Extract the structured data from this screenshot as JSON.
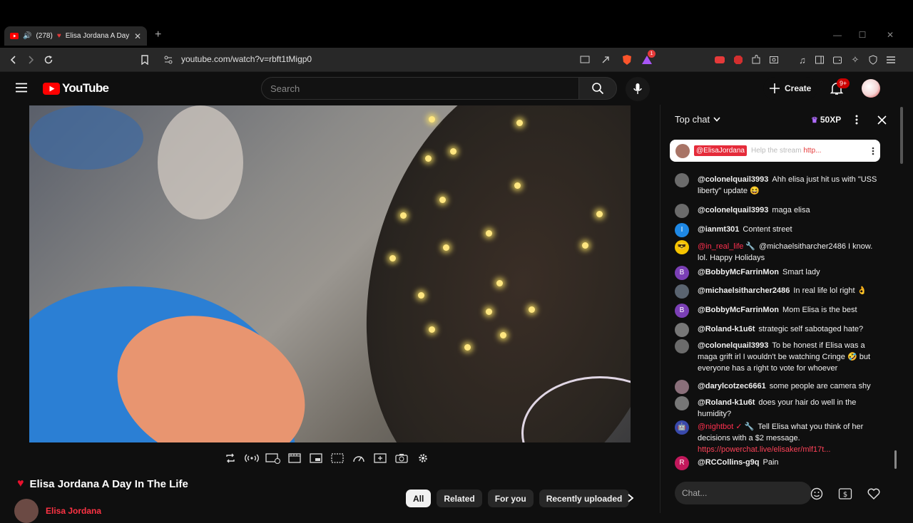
{
  "browser": {
    "tab": {
      "audio_count": "(278)",
      "title": "Elisa Jordana A Day In The Life"
    },
    "url": "youtube.com/watch?v=rbft1tMigp0",
    "brave_badge": "1"
  },
  "youtube": {
    "logo_text": "YouTube",
    "search_placeholder": "Search",
    "create_label": "Create",
    "notification_badge": "9+"
  },
  "video": {
    "title": "Elisa Jordana A Day In The Life",
    "channel": "Elisa Jordana"
  },
  "chips": [
    "All",
    "Related",
    "For you",
    "Recently uploaded"
  ],
  "chat": {
    "mode": "Top chat",
    "xp": "50XP",
    "pinned": {
      "author": "@ElisaJordana",
      "text": "Help the stream",
      "link": "http..."
    },
    "messages": [
      {
        "author": "@colonelquail3993",
        "text": "Ahh elisa just hit us with \"USS liberty\" update 😆",
        "avatar": "",
        "avatar_color": "#6b6b6b"
      },
      {
        "author": "@colonelquail3993",
        "text": "maga elisa",
        "avatar": "",
        "avatar_color": "#6b6b6b"
      },
      {
        "author": "@ianmt301",
        "text": "Content street",
        "avatar": "I",
        "avatar_color": "#1e88e5"
      },
      {
        "author": "@in_real_life 🔧",
        "text": "@michaelsitharcher2486 I know. lol. Happy Holidays",
        "avatar": "😎",
        "avatar_color": "#f5c400",
        "red": true
      },
      {
        "author": "@BobbyMcFarrinMon",
        "text": "Smart lady",
        "avatar": "B",
        "avatar_color": "#7b3fb5"
      },
      {
        "author": "@michaelsitharcher2486",
        "text": "In real life lol right 👌",
        "avatar": "",
        "avatar_color": "#5a6470"
      },
      {
        "author": "@BobbyMcFarrinMon",
        "text": "Mom Elisa is the best",
        "avatar": "B",
        "avatar_color": "#7b3fb5"
      },
      {
        "author": "@Roland-k1u6t",
        "text": "strategic self sabotaged hate?",
        "avatar": "",
        "avatar_color": "#777"
      },
      {
        "author": "@colonelquail3993",
        "text": "To be honest if Elisa was a maga grift irl I wouldn't be watching Cringe 🤣 but everyone has a right to vote for whoever",
        "avatar": "",
        "avatar_color": "#6b6b6b"
      },
      {
        "author": "@darylcotzec6661",
        "text": "some people are camera shy",
        "avatar": "",
        "avatar_color": "#8a6f7a"
      },
      {
        "author": "@Roland-k1u6t",
        "text": "does your hair do well in the humidity?",
        "avatar": "",
        "avatar_color": "#777"
      },
      {
        "author": "@nightbot ✓ 🔧",
        "text": "Tell Elisa what you think of her decisions with a $2 message.",
        "link": "https://powerchat.live/elisaker/mlf17t...",
        "avatar": "🤖",
        "avatar_color": "#3949ab",
        "red": true
      },
      {
        "author": "@RCCollins-g9q",
        "text": "Pain",
        "avatar": "R",
        "avatar_color": "#c2185b"
      }
    ],
    "input_placeholder": "Chat..."
  },
  "colors": {
    "brand_red": "#ff0000",
    "accent_red": "#e52b3a"
  }
}
